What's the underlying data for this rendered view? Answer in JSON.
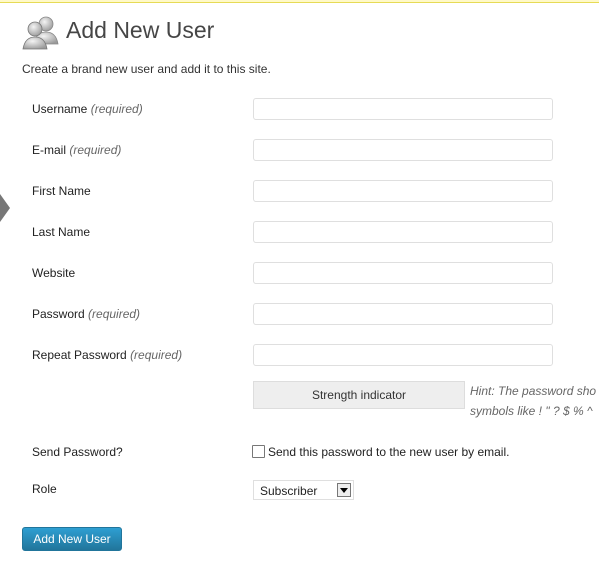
{
  "header": {
    "title": "Add New User",
    "description": "Create a brand new user and add it to this site."
  },
  "form": {
    "fields": [
      {
        "label": "Username",
        "required": "(required)",
        "value": ""
      },
      {
        "label": "E-mail",
        "required": "(required)",
        "value": ""
      },
      {
        "label": "First Name",
        "required": "",
        "value": ""
      },
      {
        "label": "Last Name",
        "required": "",
        "value": ""
      },
      {
        "label": "Website",
        "required": "",
        "value": ""
      },
      {
        "label": "Password",
        "required": "(required)",
        "value": ""
      },
      {
        "label": "Repeat Password",
        "required": "(required)",
        "value": ""
      }
    ],
    "strength_indicator": "Strength indicator",
    "hint_line1": "Hint: The password sho",
    "hint_line2": "symbols like ! \" ? $ % ^",
    "send_password": {
      "label": "Send Password?",
      "checkbox_text": "Send this password to the new user by email.",
      "checked": false
    },
    "role": {
      "label": "Role",
      "selected": "Subscriber"
    },
    "submit_label": "Add New User"
  },
  "colors": {
    "button": "#21759b",
    "notice_border": "#e6db55"
  },
  "icons": {
    "title_icon": "users-icon",
    "side_arrow": "collapse-arrow-icon"
  }
}
